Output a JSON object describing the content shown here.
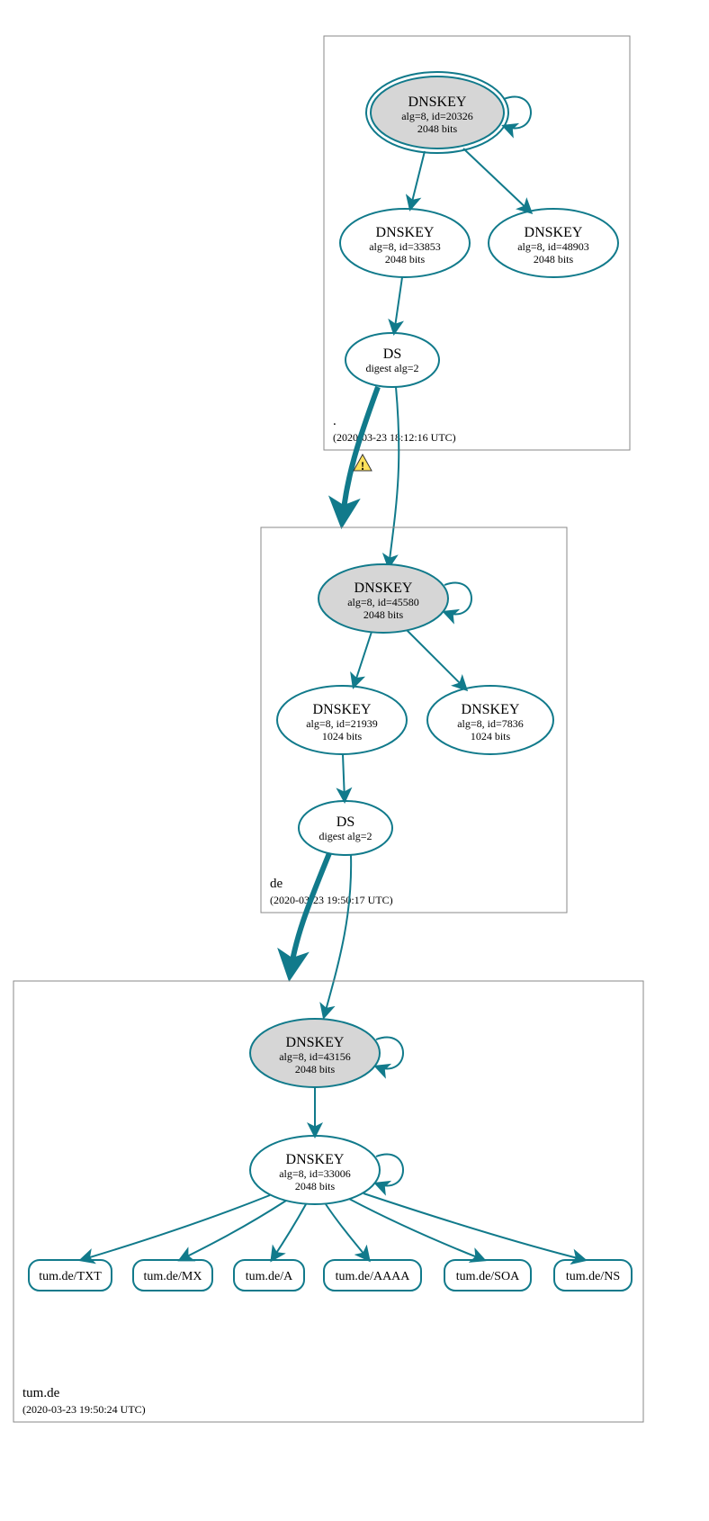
{
  "colors": {
    "teal": "#117a8b",
    "node_fill_grey": "#d6d6d6"
  },
  "zones": {
    "root": {
      "label": ".",
      "timestamp": "(2020-03-23 18:12:16 UTC)"
    },
    "de": {
      "label": "de",
      "timestamp": "(2020-03-23 19:50:17 UTC)"
    },
    "tum": {
      "label": "tum.de",
      "timestamp": "(2020-03-23 19:50:24 UTC)"
    }
  },
  "nodes": {
    "root_ksk": {
      "title": "DNSKEY",
      "sub1": "alg=8, id=20326",
      "sub2": "2048 bits"
    },
    "root_zsk": {
      "title": "DNSKEY",
      "sub1": "alg=8, id=33853",
      "sub2": "2048 bits"
    },
    "root_k3": {
      "title": "DNSKEY",
      "sub1": "alg=8, id=48903",
      "sub2": "2048 bits"
    },
    "root_ds": {
      "title": "DS",
      "sub1": "digest alg=2"
    },
    "de_ksk": {
      "title": "DNSKEY",
      "sub1": "alg=8, id=45580",
      "sub2": "2048 bits"
    },
    "de_zsk": {
      "title": "DNSKEY",
      "sub1": "alg=8, id=21939",
      "sub2": "1024 bits"
    },
    "de_k3": {
      "title": "DNSKEY",
      "sub1": "alg=8, id=7836",
      "sub2": "1024 bits"
    },
    "de_ds": {
      "title": "DS",
      "sub1": "digest alg=2"
    },
    "tum_ksk": {
      "title": "DNSKEY",
      "sub1": "alg=8, id=43156",
      "sub2": "2048 bits"
    },
    "tum_zsk": {
      "title": "DNSKEY",
      "sub1": "alg=8, id=33006",
      "sub2": "2048 bits"
    }
  },
  "rrs": {
    "txt": "tum.de/TXT",
    "mx": "tum.de/MX",
    "a": "tum.de/A",
    "aaaa": "tum.de/AAAA",
    "soa": "tum.de/SOA",
    "ns": "tum.de/NS"
  },
  "warning": {
    "glyph": "!"
  }
}
